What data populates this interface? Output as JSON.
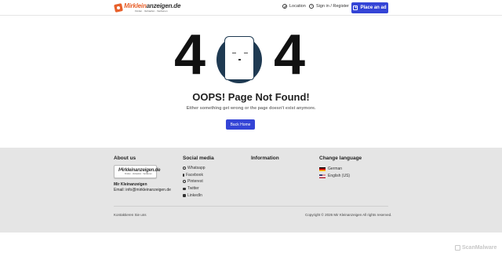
{
  "header": {
    "logo_word_a": "Mirklein",
    "logo_word_b": "anzeigen",
    "logo_word_c": ".de",
    "logo_tagline": "Finden · Verkaufen · Verdienen",
    "location_label": "Location",
    "signin_label": "Sign in / Register",
    "place_ad_label": "Place an ad"
  },
  "error": {
    "digit_left": "4",
    "digit_right": "4",
    "title": "OOPS! Page Not Found!",
    "subtitle": "Either something get wrong or the page doesn't exist anymore.",
    "back_home_label": "Back Home"
  },
  "footer": {
    "about": {
      "heading": "About us",
      "company": "Mir Kleinanzeigen",
      "email": "Email: info@mirkleinanzeigen.de"
    },
    "social": {
      "heading": "Social media",
      "items": [
        "Whatsapp",
        "Facebook",
        "Pinterest",
        "Twitter",
        "LinkedIn"
      ]
    },
    "information": {
      "heading": "Information"
    },
    "language": {
      "heading": "Change language",
      "items": [
        "German",
        "English (US)"
      ]
    },
    "contact_label": "Kontaktieren Sie uns",
    "copyright": "Copyright © 2026 Mir Kleinanzeigen All rights reserved."
  },
  "watermark": "ScanMalware",
  "colors": {
    "accent": "#3444d6",
    "logo_orange": "#e8612c",
    "footer_bg": "#e5e5e5",
    "face_dark": "#1f3a52"
  }
}
